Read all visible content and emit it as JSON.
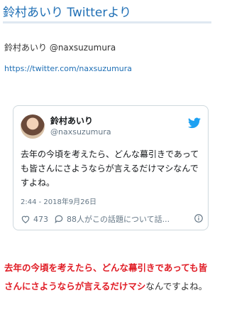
{
  "article": {
    "title": "鈴村あいり Twitterより",
    "source_name_line": "鈴村あいり @naxsuzumura",
    "source_url": "https://twitter.com/naxsuzumura"
  },
  "tweet": {
    "display_name": "鈴村あいり",
    "handle": "@naxsuzumura",
    "text": "去年の今頃を考えたら、どんな幕引きであっても皆さんにさようならが言えるだけマシなんですよね。",
    "timestamp": "2:44 - 2018年9月26日",
    "like_count": "473",
    "reply_summary": "88人がこの話題について話..."
  },
  "body": {
    "highlighted": "去年の今頃を考えたら、どんな幕引きであっても皆さんにさようならが言えるだけマシ",
    "rest": "なんですよね。"
  },
  "colors": {
    "link": "#1f6fb5",
    "highlight": "#e01b24",
    "twitter_blue": "#1da1f2"
  }
}
